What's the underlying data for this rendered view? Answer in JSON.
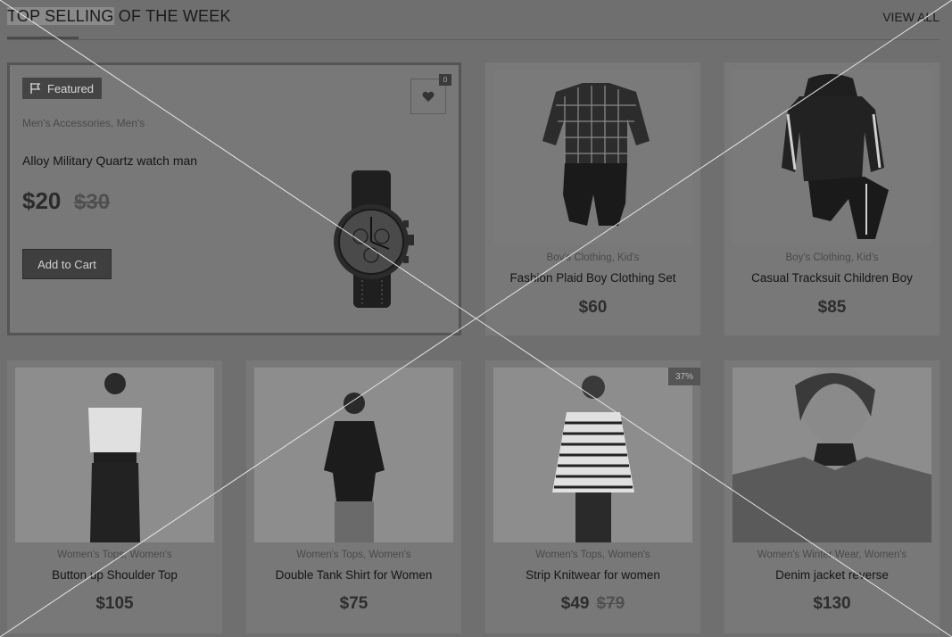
{
  "section": {
    "title_highlight": "TOP SELLING",
    "title_rest": " OF THE WEEK",
    "view_all": "VIEW ALL"
  },
  "featured": {
    "badge": "Featured",
    "wishlist_count": "0",
    "categories": "Men's Accessories, Men's",
    "name": "Alloy Military Quartz watch man",
    "price": "$20",
    "old_price": "$30",
    "button": "Add to Cart"
  },
  "products": [
    {
      "categories": "Boy's Clothing, Kid's",
      "name": "Fashion Plaid Boy Clothing Set",
      "price": "$60"
    },
    {
      "categories": "Boy's Clothing, Kid's",
      "name": "Casual Tracksuit Children Boy",
      "price": "$85"
    },
    {
      "categories": "Women's Tops, Women's",
      "name": "Button up Shoulder Top",
      "price": "$105"
    },
    {
      "categories": "Women's Tops, Women's",
      "name": "Double Tank Shirt for Women",
      "price": "$75"
    },
    {
      "categories": "Women's Tops, Women's",
      "name": "Strip Knitwear for women",
      "price": "$49",
      "old_price": "$79",
      "badge": "37%"
    },
    {
      "categories": "Women's Winter Wear, Women's",
      "name": "Denim jacket reverse",
      "price": "$130"
    }
  ],
  "icons": {
    "featured": "flag-icon",
    "wishlist": "heart-icon"
  }
}
